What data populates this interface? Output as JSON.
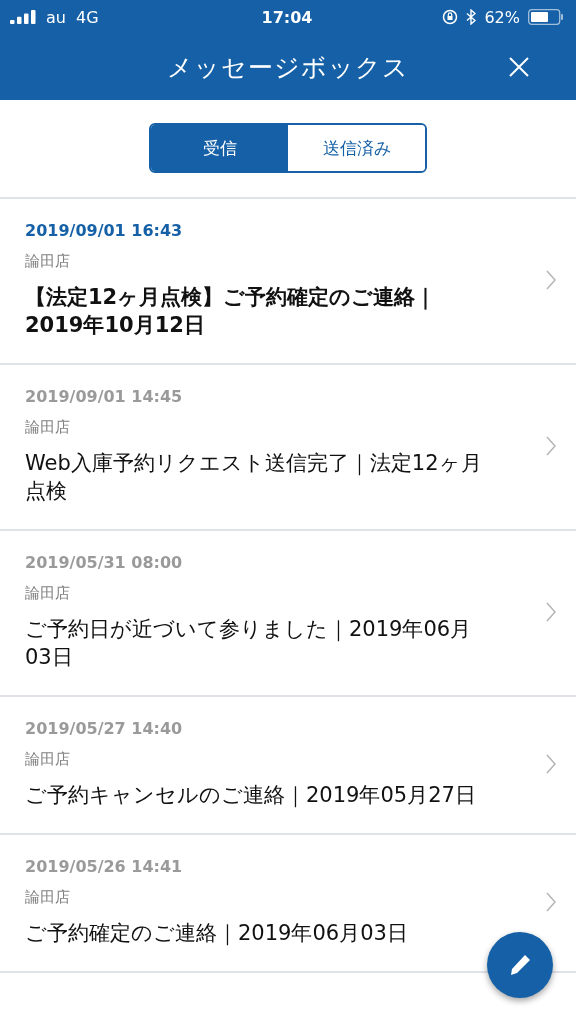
{
  "status_bar": {
    "carrier": "au",
    "network": "4G",
    "time": "17:04",
    "battery": "62%"
  },
  "header": {
    "title": "メッセージボックス"
  },
  "tabs": [
    {
      "label": "受信",
      "selected": true
    },
    {
      "label": "送信済み",
      "selected": false
    }
  ],
  "messages": [
    {
      "date": "2019/09/01 16:43",
      "sender": "論田店",
      "title": "【法定12ヶ月点検】ご予約確定のご連絡｜2019年10月12日",
      "unread": true
    },
    {
      "date": "2019/09/01 14:45",
      "sender": "論田店",
      "title": "Web入庫予約リクエスト送信完了｜法定12ヶ月点検",
      "unread": false
    },
    {
      "date": "2019/05/31 08:00",
      "sender": "論田店",
      "title": "ご予約日が近づいて参りました｜2019年06月03日",
      "unread": false
    },
    {
      "date": "2019/05/27 14:40",
      "sender": "論田店",
      "title": "ご予約キャンセルのご連絡｜2019年05月27日",
      "unread": false
    },
    {
      "date": "2019/05/26 14:41",
      "sender": "論田店",
      "title": "ご予約確定のご連絡｜2019年06月03日",
      "unread": false
    }
  ]
}
